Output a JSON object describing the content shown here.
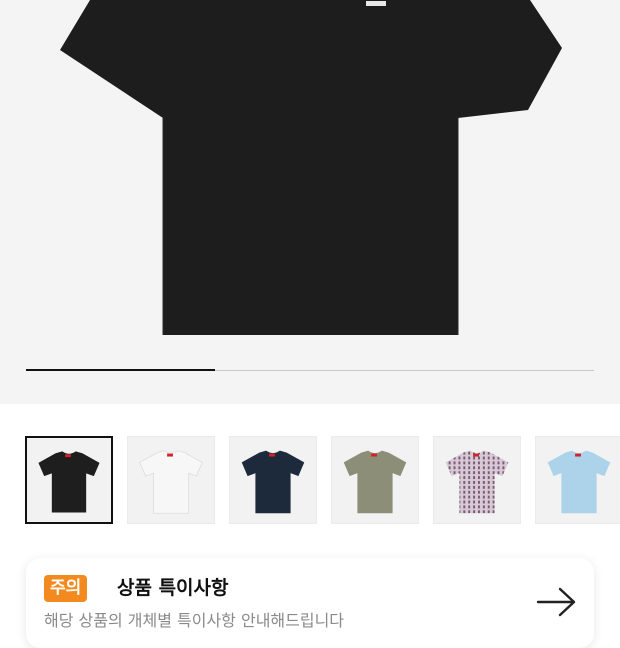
{
  "product": {
    "image_alt": "black t-shirt main image",
    "image_counter": {
      "current": 1,
      "total": 3
    },
    "brand_print_on_image": "Supreme"
  },
  "thumbnails": [
    {
      "color_name": "black",
      "color": "#1e1e1e",
      "selected": true
    },
    {
      "color_name": "white",
      "color": "#f7f7f7",
      "selected": false
    },
    {
      "color_name": "navy",
      "color": "#1c2a3c",
      "selected": false
    },
    {
      "color_name": "olive",
      "color": "#8d8e78",
      "selected": false
    },
    {
      "color_name": "pattern",
      "color": "#d7c9d6",
      "selected": false
    },
    {
      "color_name": "light-blue",
      "color": "#acd3ea",
      "selected": false
    }
  ],
  "notice": {
    "badge": "주의",
    "title": "상품 특이사항",
    "description": "해당 상품의 개체별 특이사항 안내해드립니다",
    "arrow_icon": "arrow-right-icon"
  }
}
